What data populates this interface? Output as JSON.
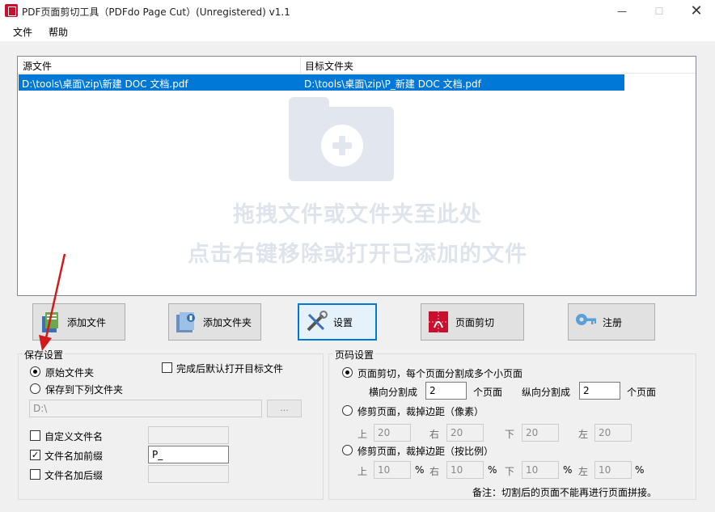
{
  "window": {
    "title": "PDF页面剪切工具（PDFdo Page Cut）(Unregistered) v1.1",
    "min_glyph": "—",
    "max_glyph": "☐",
    "close_glyph": "✕"
  },
  "menu": {
    "file": "文件",
    "help": "帮助"
  },
  "file_list": {
    "col_source": "源文件",
    "col_target": "目标文件夹",
    "rows": [
      {
        "source": "D:\\tools\\桌面\\zip\\新建 DOC 文档.pdf",
        "target": "D:\\tools\\桌面\\zip\\P_新建 DOC 文档.pdf"
      }
    ],
    "hint_line1": "拖拽文件或文件夹至此处",
    "hint_line2": "点击右键移除或打开已添加的文件"
  },
  "toolbar": {
    "add_file": "添加文件",
    "add_folder": "添加文件夹",
    "settings": "设置",
    "page_cut": "页面剪切",
    "register": "注册"
  },
  "save_settings": {
    "title": "保存设置",
    "original_folder": "原始文件夹",
    "save_to_folder": "保存到下列文件夹",
    "open_after": "完成后默认打开目标文件",
    "folder_path": "D:\\",
    "browse": "...",
    "custom_filename": "自定义文件名",
    "custom_filename_value": "",
    "add_prefix": "文件名加前缀",
    "prefix_value": "P_",
    "add_suffix": "文件名加后缀",
    "suffix_value": "",
    "check_mark": "✓"
  },
  "page_settings": {
    "title": "页码设置",
    "option_cut": "页面剪切，每个页面分割成多个小页面",
    "horizontal_label": "横向分割成",
    "horizontal_value": "2",
    "horizontal_unit": "个页面",
    "vertical_label": "纵向分割成",
    "vertical_value": "2",
    "vertical_unit": "个页面",
    "option_trim_px": "修剪页面，裁掉边距（像素）",
    "top": "上",
    "right": "右",
    "bottom": "下",
    "left": "左",
    "px_top": "20",
    "px_right": "20",
    "px_bottom": "20",
    "px_left": "20",
    "option_trim_ratio": "修剪页面，裁掉边距（按比例）",
    "pct_top": "10",
    "pct_right": "10",
    "pct_bottom": "10",
    "pct_left": "10",
    "percent": "%",
    "note": "备注：切割后的页面不能再进行页面拼接。"
  },
  "colors": {
    "selection": "#0078d7",
    "arrow": "#d11a1a",
    "hint_text": "#dfe4ec"
  }
}
